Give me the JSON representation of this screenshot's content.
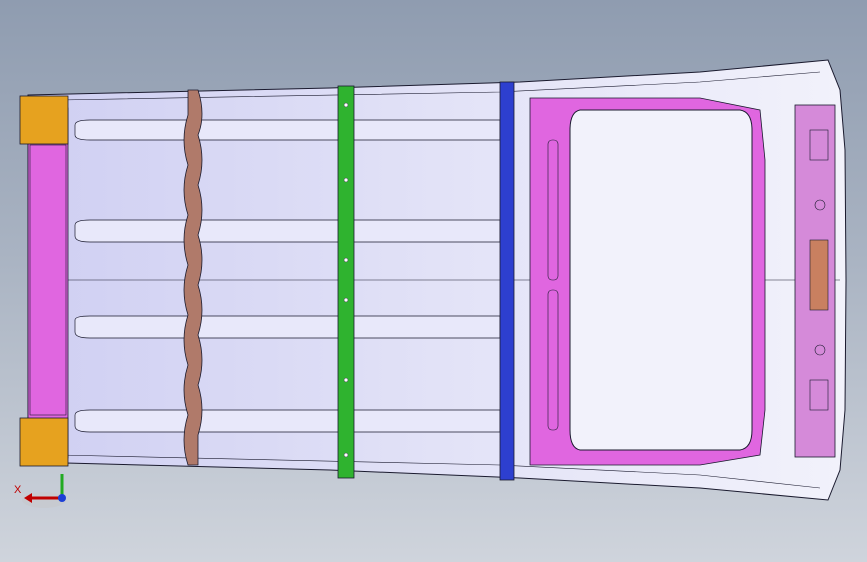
{
  "viewport": {
    "background_top": "#8f9cb0",
    "background_bottom": "#cfd4dc"
  },
  "model": {
    "panel_fill": "#dcdcf5",
    "outline_color": "#1a1a2e",
    "ribbed_bow_color": "#b07a6a",
    "center_bow_color": "#2fb32f",
    "rear_bow_color": "#2d3fcf",
    "header_color": "#e066e0",
    "bracket_color": "#e6a21f",
    "sunroof_frame_color": "#e066e0",
    "rear_panel_color": "#d58ad9"
  },
  "triad": {
    "x_label": "X",
    "x_color": "#c00000",
    "z_color": "#22aa22",
    "origin_color": "#1c3fd6"
  }
}
